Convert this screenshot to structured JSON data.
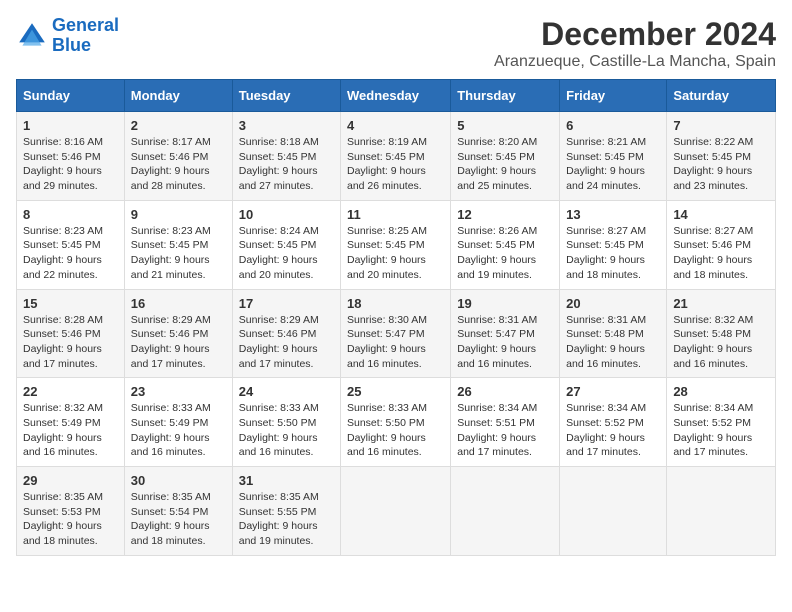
{
  "logo": {
    "line1": "General",
    "line2": "Blue"
  },
  "title": "December 2024",
  "subtitle": "Aranzueque, Castille-La Mancha, Spain",
  "days_of_week": [
    "Sunday",
    "Monday",
    "Tuesday",
    "Wednesday",
    "Thursday",
    "Friday",
    "Saturday"
  ],
  "weeks": [
    [
      {
        "day": "1",
        "sunrise": "Sunrise: 8:16 AM",
        "sunset": "Sunset: 5:46 PM",
        "daylight": "Daylight: 9 hours and 29 minutes."
      },
      {
        "day": "2",
        "sunrise": "Sunrise: 8:17 AM",
        "sunset": "Sunset: 5:46 PM",
        "daylight": "Daylight: 9 hours and 28 minutes."
      },
      {
        "day": "3",
        "sunrise": "Sunrise: 8:18 AM",
        "sunset": "Sunset: 5:45 PM",
        "daylight": "Daylight: 9 hours and 27 minutes."
      },
      {
        "day": "4",
        "sunrise": "Sunrise: 8:19 AM",
        "sunset": "Sunset: 5:45 PM",
        "daylight": "Daylight: 9 hours and 26 minutes."
      },
      {
        "day": "5",
        "sunrise": "Sunrise: 8:20 AM",
        "sunset": "Sunset: 5:45 PM",
        "daylight": "Daylight: 9 hours and 25 minutes."
      },
      {
        "day": "6",
        "sunrise": "Sunrise: 8:21 AM",
        "sunset": "Sunset: 5:45 PM",
        "daylight": "Daylight: 9 hours and 24 minutes."
      },
      {
        "day": "7",
        "sunrise": "Sunrise: 8:22 AM",
        "sunset": "Sunset: 5:45 PM",
        "daylight": "Daylight: 9 hours and 23 minutes."
      }
    ],
    [
      {
        "day": "8",
        "sunrise": "Sunrise: 8:23 AM",
        "sunset": "Sunset: 5:45 PM",
        "daylight": "Daylight: 9 hours and 22 minutes."
      },
      {
        "day": "9",
        "sunrise": "Sunrise: 8:23 AM",
        "sunset": "Sunset: 5:45 PM",
        "daylight": "Daylight: 9 hours and 21 minutes."
      },
      {
        "day": "10",
        "sunrise": "Sunrise: 8:24 AM",
        "sunset": "Sunset: 5:45 PM",
        "daylight": "Daylight: 9 hours and 20 minutes."
      },
      {
        "day": "11",
        "sunrise": "Sunrise: 8:25 AM",
        "sunset": "Sunset: 5:45 PM",
        "daylight": "Daylight: 9 hours and 20 minutes."
      },
      {
        "day": "12",
        "sunrise": "Sunrise: 8:26 AM",
        "sunset": "Sunset: 5:45 PM",
        "daylight": "Daylight: 9 hours and 19 minutes."
      },
      {
        "day": "13",
        "sunrise": "Sunrise: 8:27 AM",
        "sunset": "Sunset: 5:45 PM",
        "daylight": "Daylight: 9 hours and 18 minutes."
      },
      {
        "day": "14",
        "sunrise": "Sunrise: 8:27 AM",
        "sunset": "Sunset: 5:46 PM",
        "daylight": "Daylight: 9 hours and 18 minutes."
      }
    ],
    [
      {
        "day": "15",
        "sunrise": "Sunrise: 8:28 AM",
        "sunset": "Sunset: 5:46 PM",
        "daylight": "Daylight: 9 hours and 17 minutes."
      },
      {
        "day": "16",
        "sunrise": "Sunrise: 8:29 AM",
        "sunset": "Sunset: 5:46 PM",
        "daylight": "Daylight: 9 hours and 17 minutes."
      },
      {
        "day": "17",
        "sunrise": "Sunrise: 8:29 AM",
        "sunset": "Sunset: 5:46 PM",
        "daylight": "Daylight: 9 hours and 17 minutes."
      },
      {
        "day": "18",
        "sunrise": "Sunrise: 8:30 AM",
        "sunset": "Sunset: 5:47 PM",
        "daylight": "Daylight: 9 hours and 16 minutes."
      },
      {
        "day": "19",
        "sunrise": "Sunrise: 8:31 AM",
        "sunset": "Sunset: 5:47 PM",
        "daylight": "Daylight: 9 hours and 16 minutes."
      },
      {
        "day": "20",
        "sunrise": "Sunrise: 8:31 AM",
        "sunset": "Sunset: 5:48 PM",
        "daylight": "Daylight: 9 hours and 16 minutes."
      },
      {
        "day": "21",
        "sunrise": "Sunrise: 8:32 AM",
        "sunset": "Sunset: 5:48 PM",
        "daylight": "Daylight: 9 hours and 16 minutes."
      }
    ],
    [
      {
        "day": "22",
        "sunrise": "Sunrise: 8:32 AM",
        "sunset": "Sunset: 5:49 PM",
        "daylight": "Daylight: 9 hours and 16 minutes."
      },
      {
        "day": "23",
        "sunrise": "Sunrise: 8:33 AM",
        "sunset": "Sunset: 5:49 PM",
        "daylight": "Daylight: 9 hours and 16 minutes."
      },
      {
        "day": "24",
        "sunrise": "Sunrise: 8:33 AM",
        "sunset": "Sunset: 5:50 PM",
        "daylight": "Daylight: 9 hours and 16 minutes."
      },
      {
        "day": "25",
        "sunrise": "Sunrise: 8:33 AM",
        "sunset": "Sunset: 5:50 PM",
        "daylight": "Daylight: 9 hours and 16 minutes."
      },
      {
        "day": "26",
        "sunrise": "Sunrise: 8:34 AM",
        "sunset": "Sunset: 5:51 PM",
        "daylight": "Daylight: 9 hours and 17 minutes."
      },
      {
        "day": "27",
        "sunrise": "Sunrise: 8:34 AM",
        "sunset": "Sunset: 5:52 PM",
        "daylight": "Daylight: 9 hours and 17 minutes."
      },
      {
        "day": "28",
        "sunrise": "Sunrise: 8:34 AM",
        "sunset": "Sunset: 5:52 PM",
        "daylight": "Daylight: 9 hours and 17 minutes."
      }
    ],
    [
      {
        "day": "29",
        "sunrise": "Sunrise: 8:35 AM",
        "sunset": "Sunset: 5:53 PM",
        "daylight": "Daylight: 9 hours and 18 minutes."
      },
      {
        "day": "30",
        "sunrise": "Sunrise: 8:35 AM",
        "sunset": "Sunset: 5:54 PM",
        "daylight": "Daylight: 9 hours and 18 minutes."
      },
      {
        "day": "31",
        "sunrise": "Sunrise: 8:35 AM",
        "sunset": "Sunset: 5:55 PM",
        "daylight": "Daylight: 9 hours and 19 minutes."
      },
      null,
      null,
      null,
      null
    ]
  ]
}
